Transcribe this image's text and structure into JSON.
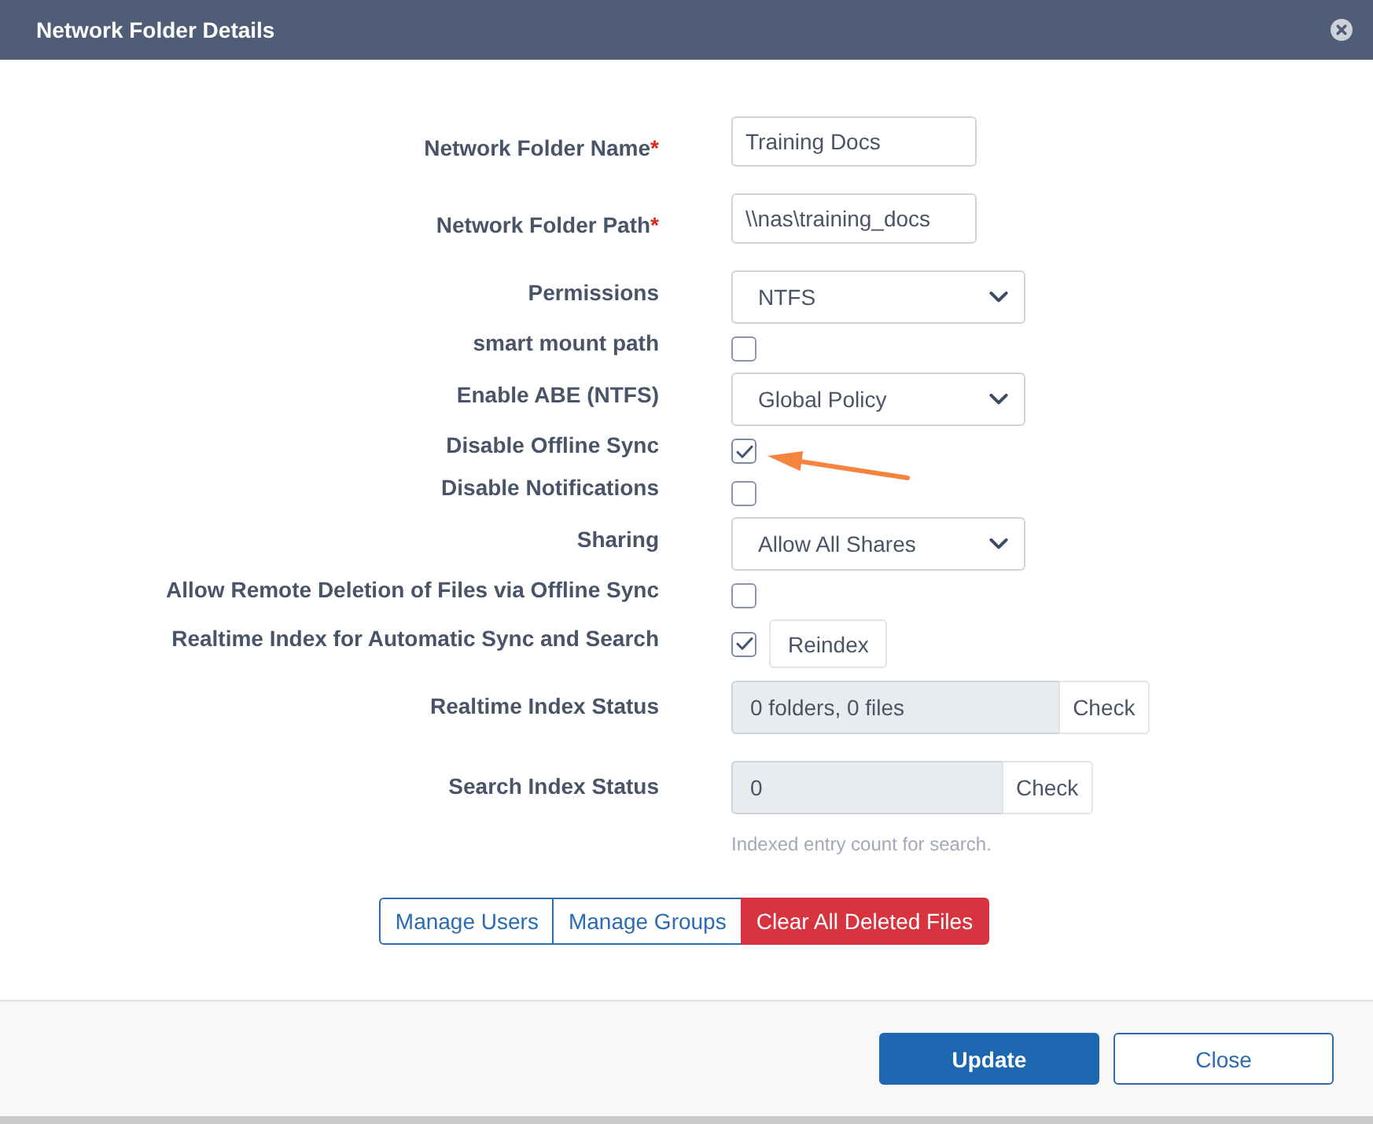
{
  "window": {
    "title": "Network Folder Details"
  },
  "form": {
    "rows": [
      {
        "kind": "text",
        "label": "Network Folder Name",
        "required_mark": "*",
        "value": "Training Docs",
        "arrow": false
      },
      {
        "kind": "text",
        "label": "Network Folder Path",
        "required_mark": "*",
        "value": "\\\\nas\\training_docs",
        "arrow": false
      },
      {
        "kind": "select",
        "label": "Permissions",
        "value": "NTFS",
        "arrow": false
      },
      {
        "kind": "checkbox",
        "label": "smart mount path",
        "checked": false,
        "arrow": false
      },
      {
        "kind": "select",
        "label": "Enable ABE (NTFS)",
        "value": "Global Policy",
        "arrow": false
      },
      {
        "kind": "checkbox",
        "label": "Disable Offline Sync",
        "checked": true,
        "arrow": true
      },
      {
        "kind": "checkbox",
        "label": "Disable Notifications",
        "checked": false,
        "arrow": false
      },
      {
        "kind": "select",
        "label": "Sharing",
        "value": "Allow All Shares",
        "arrow": false
      },
      {
        "kind": "checkbox",
        "label": "Allow Remote Deletion of Files via Offline Sync",
        "checked": false,
        "arrow": false
      },
      {
        "kind": "checkbox",
        "label": "Realtime Index for Automatic Sync and Search",
        "checked": true,
        "button": "Reindex",
        "arrow": false
      },
      {
        "kind": "status",
        "label": "Realtime Index Status",
        "value": "0 folders, 0 files",
        "button": "Check",
        "arrow": false
      },
      {
        "kind": "status",
        "label": "Search Index Status",
        "value": "0",
        "button": "Check",
        "help": "Indexed entry count for search.",
        "arrow": false
      }
    ]
  },
  "actions": [
    {
      "label": "Manage Users",
      "kind": "outline"
    },
    {
      "label": "Manage Groups",
      "kind": "outline"
    },
    {
      "label": "Clear All Deleted Files",
      "kind": "danger"
    }
  ],
  "footer": {
    "buttons": [
      {
        "label": "Update",
        "kind": "primary"
      },
      {
        "label": "Close",
        "kind": "outline"
      }
    ]
  }
}
